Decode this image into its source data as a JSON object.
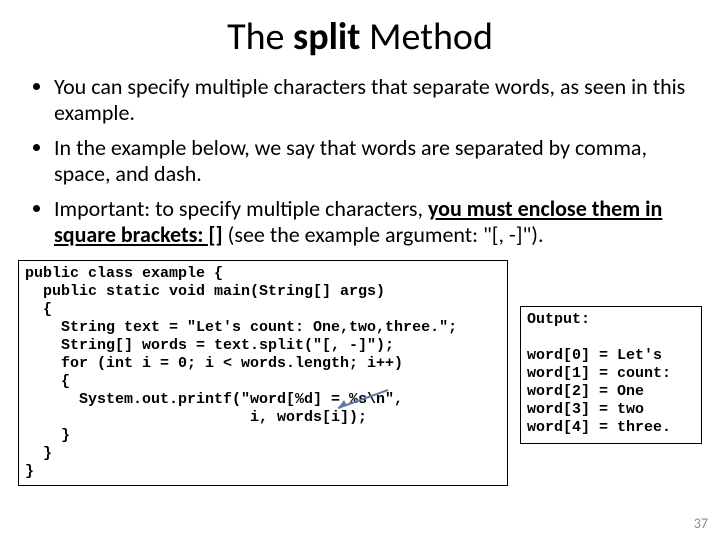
{
  "title": {
    "pre": "The ",
    "strong": "split",
    "post": " Method"
  },
  "bullets": [
    "You can specify multiple characters that separate words, as seen in this example.",
    "In the example below, we say that words are separated by comma, space, and dash.",
    {
      "lead": "Important: to specify multiple characters, ",
      "u1": "you must enclose them in square brackets: []",
      "tail": " (see the example argument: \"[, -]\")."
    }
  ],
  "code": "public class example {\n  public static void main(String[] args)\n  {\n    String text = \"Let's count: One,two,three.\";\n    String[] words = text.split(\"[, -]\");\n    for (int i = 0; i < words.length; i++)\n    {\n      System.out.printf(\"word[%d] = %s\\n\",\n                         i, words[i]);\n    }\n  }\n}",
  "output": "Output:\n\nword[0] = Let's\nword[1] = count:\nword[2] = One\nword[3] = two\nword[4] = three.",
  "slidenum": "37"
}
